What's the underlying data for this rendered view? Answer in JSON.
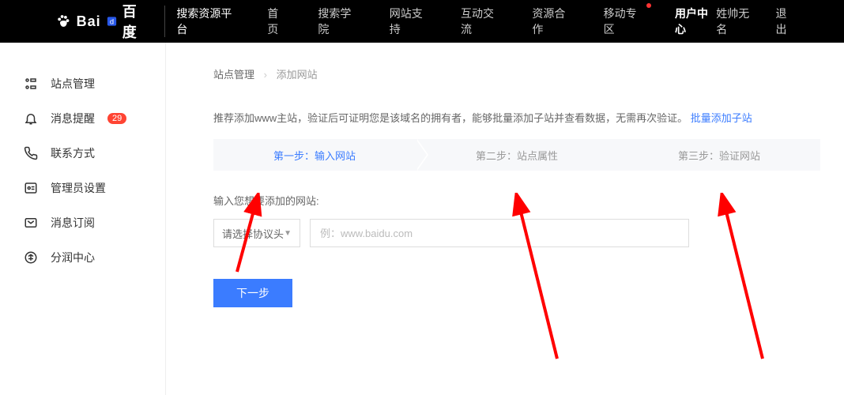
{
  "header": {
    "logo_text": "Bai",
    "logo_text2": "百度",
    "sub_title": "搜索资源平台",
    "nav": [
      "首页",
      "搜索学院",
      "网站支持",
      "互动交流",
      "资源合作",
      "移动专区",
      "用户中心"
    ],
    "nav_active_index": 6,
    "nav_dot_index": 5,
    "user_name": "姓帅无名",
    "logout": "退出"
  },
  "sidebar": {
    "items": [
      {
        "label": "站点管理",
        "badge": null
      },
      {
        "label": "消息提醒",
        "badge": "29"
      },
      {
        "label": "联系方式",
        "badge": null
      },
      {
        "label": "管理员设置",
        "badge": null
      },
      {
        "label": "消息订阅",
        "badge": null
      },
      {
        "label": "分润中心",
        "badge": null
      }
    ]
  },
  "breadcrumb": {
    "parent": "站点管理",
    "sep": "›",
    "current": "添加网站"
  },
  "tip": {
    "text": "推荐添加www主站，验证后可证明您是该域名的拥有者，能够批量添加子站并查看数据，无需再次验证。",
    "link": "批量添加子站"
  },
  "steps": [
    "第一步：输入网站",
    "第二步：站点属性",
    "第三步：验证网站"
  ],
  "steps_active_index": 0,
  "form": {
    "label": "输入您想要添加的网站:",
    "protocol_placeholder": "请选择协议头",
    "url_placeholder": "例：www.baidu.com",
    "next_btn": "下一步"
  },
  "colors": {
    "accent": "#3b7cff",
    "danger": "#f43",
    "arrow": "#ff0000"
  }
}
